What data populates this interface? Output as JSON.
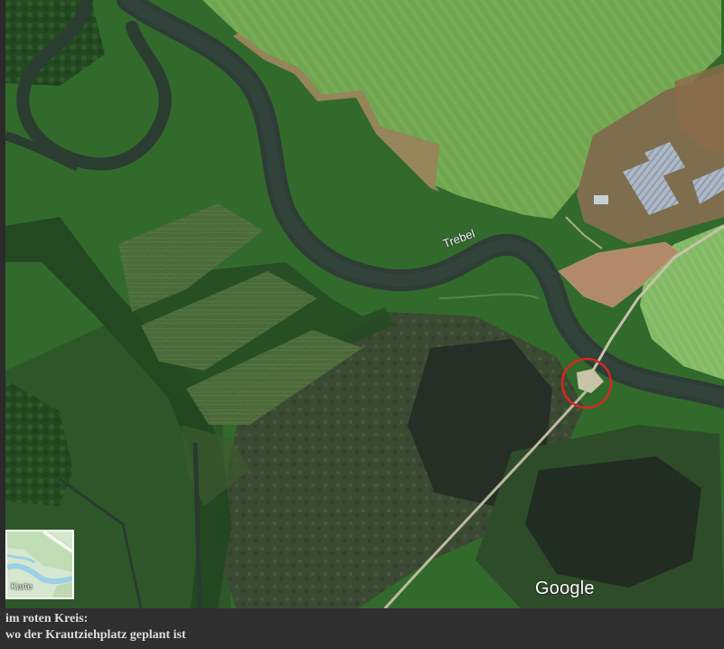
{
  "map": {
    "river_label": "Trebel",
    "brand": "Google",
    "map_type_button": {
      "label": "Karte"
    }
  },
  "caption": {
    "line1": "im roten Kreis:",
    "line2": "wo der Krautziehplatz geplant ist"
  },
  "colors": {
    "field": "#6fa44e",
    "dark_green": "#244b22",
    "river": "#2d3f37",
    "marker": "#d42822",
    "bg": "#2f2f2f",
    "text": "#dcdcdc"
  }
}
